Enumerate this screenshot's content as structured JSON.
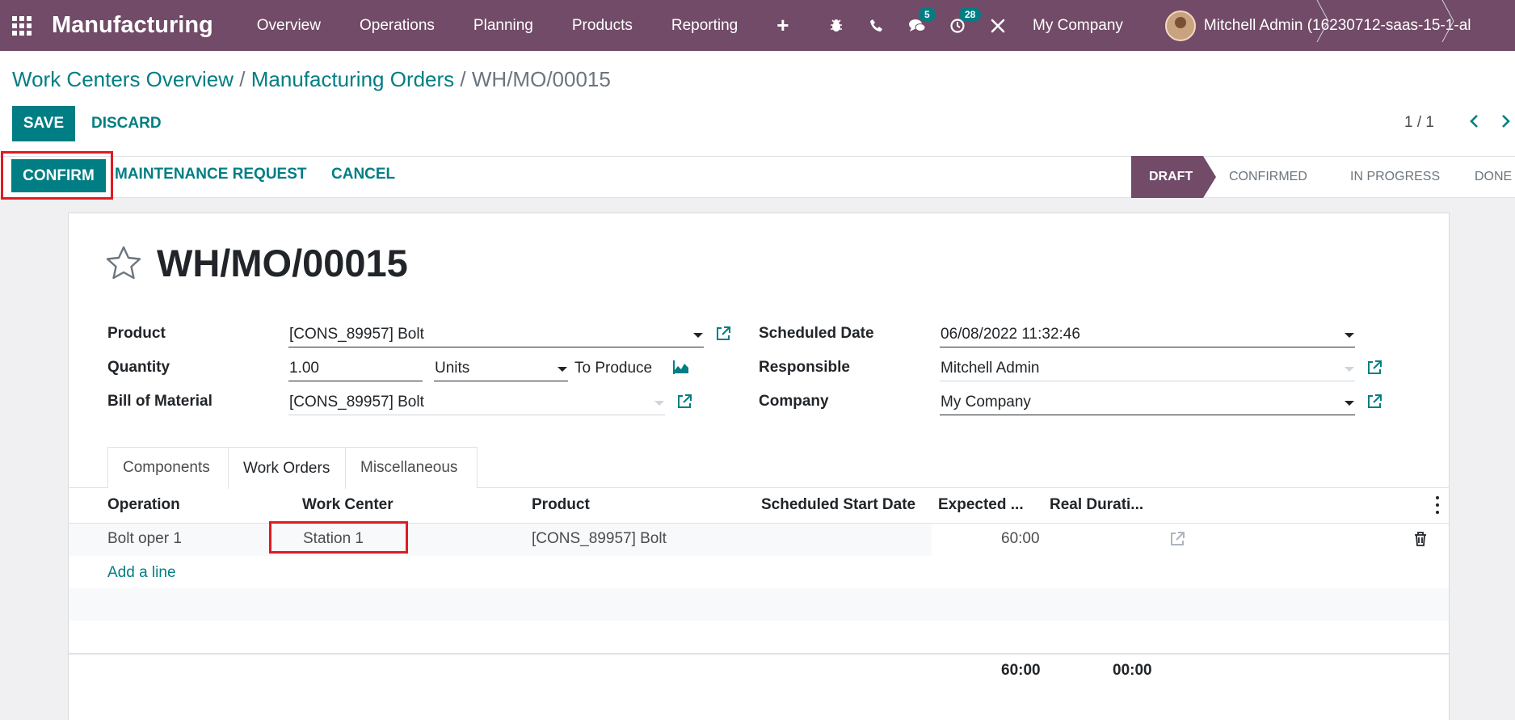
{
  "navbar": {
    "app_name": "Manufacturing",
    "menu": [
      "Overview",
      "Operations",
      "Planning",
      "Products",
      "Reporting"
    ],
    "messages_count": "5",
    "activities_count": "28",
    "company": "My Company",
    "user": "Mitchell Admin (16230712-saas-15-1-al"
  },
  "breadcrumb": {
    "items": [
      "Work Centers Overview",
      "Manufacturing Orders"
    ],
    "separator": "/",
    "current": "WH/MO/00015"
  },
  "toolbar": {
    "save_label": "SAVE",
    "discard_label": "DISCARD"
  },
  "pager": {
    "value": "1 / 1"
  },
  "statusbar": {
    "confirm_label": "CONFIRM",
    "maintenance_label": "MAINTENANCE REQUEST",
    "cancel_label": "CANCEL",
    "stages": [
      "DRAFT",
      "CONFIRMED",
      "IN PROGRESS",
      "DONE"
    ],
    "active_stage": "DRAFT"
  },
  "form": {
    "title": "WH/MO/00015",
    "product_label": "Product",
    "product_value": "[CONS_89957] Bolt",
    "quantity_label": "Quantity",
    "quantity_value": "1.00",
    "uom_value": "Units",
    "to_produce": "To Produce",
    "bom_label": "Bill of Material",
    "bom_value": "[CONS_89957] Bolt",
    "scheduled_label": "Scheduled Date",
    "scheduled_value": "06/08/2022 11:32:46",
    "responsible_label": "Responsible",
    "responsible_value": "Mitchell Admin",
    "company_label": "Company",
    "company_value": "My Company"
  },
  "tabs": [
    "Components",
    "Work Orders",
    "Miscellaneous"
  ],
  "active_tab": "Work Orders",
  "work_orders": {
    "columns": [
      "Operation",
      "Work Center",
      "Product",
      "Scheduled Start Date",
      "Expected ...",
      "Real Durati..."
    ],
    "rows": [
      {
        "operation": "Bolt oper 1",
        "work_center": "Station 1",
        "product": "[CONS_89957] Bolt",
        "scheduled_start": "",
        "expected": "60:00",
        "real": ""
      }
    ],
    "add_line": "Add a line",
    "totals": {
      "expected": "60:00",
      "real": "00:00"
    }
  },
  "colors": {
    "brand": "#714b67",
    "accent": "#017e84",
    "highlight": "#e01b24"
  }
}
